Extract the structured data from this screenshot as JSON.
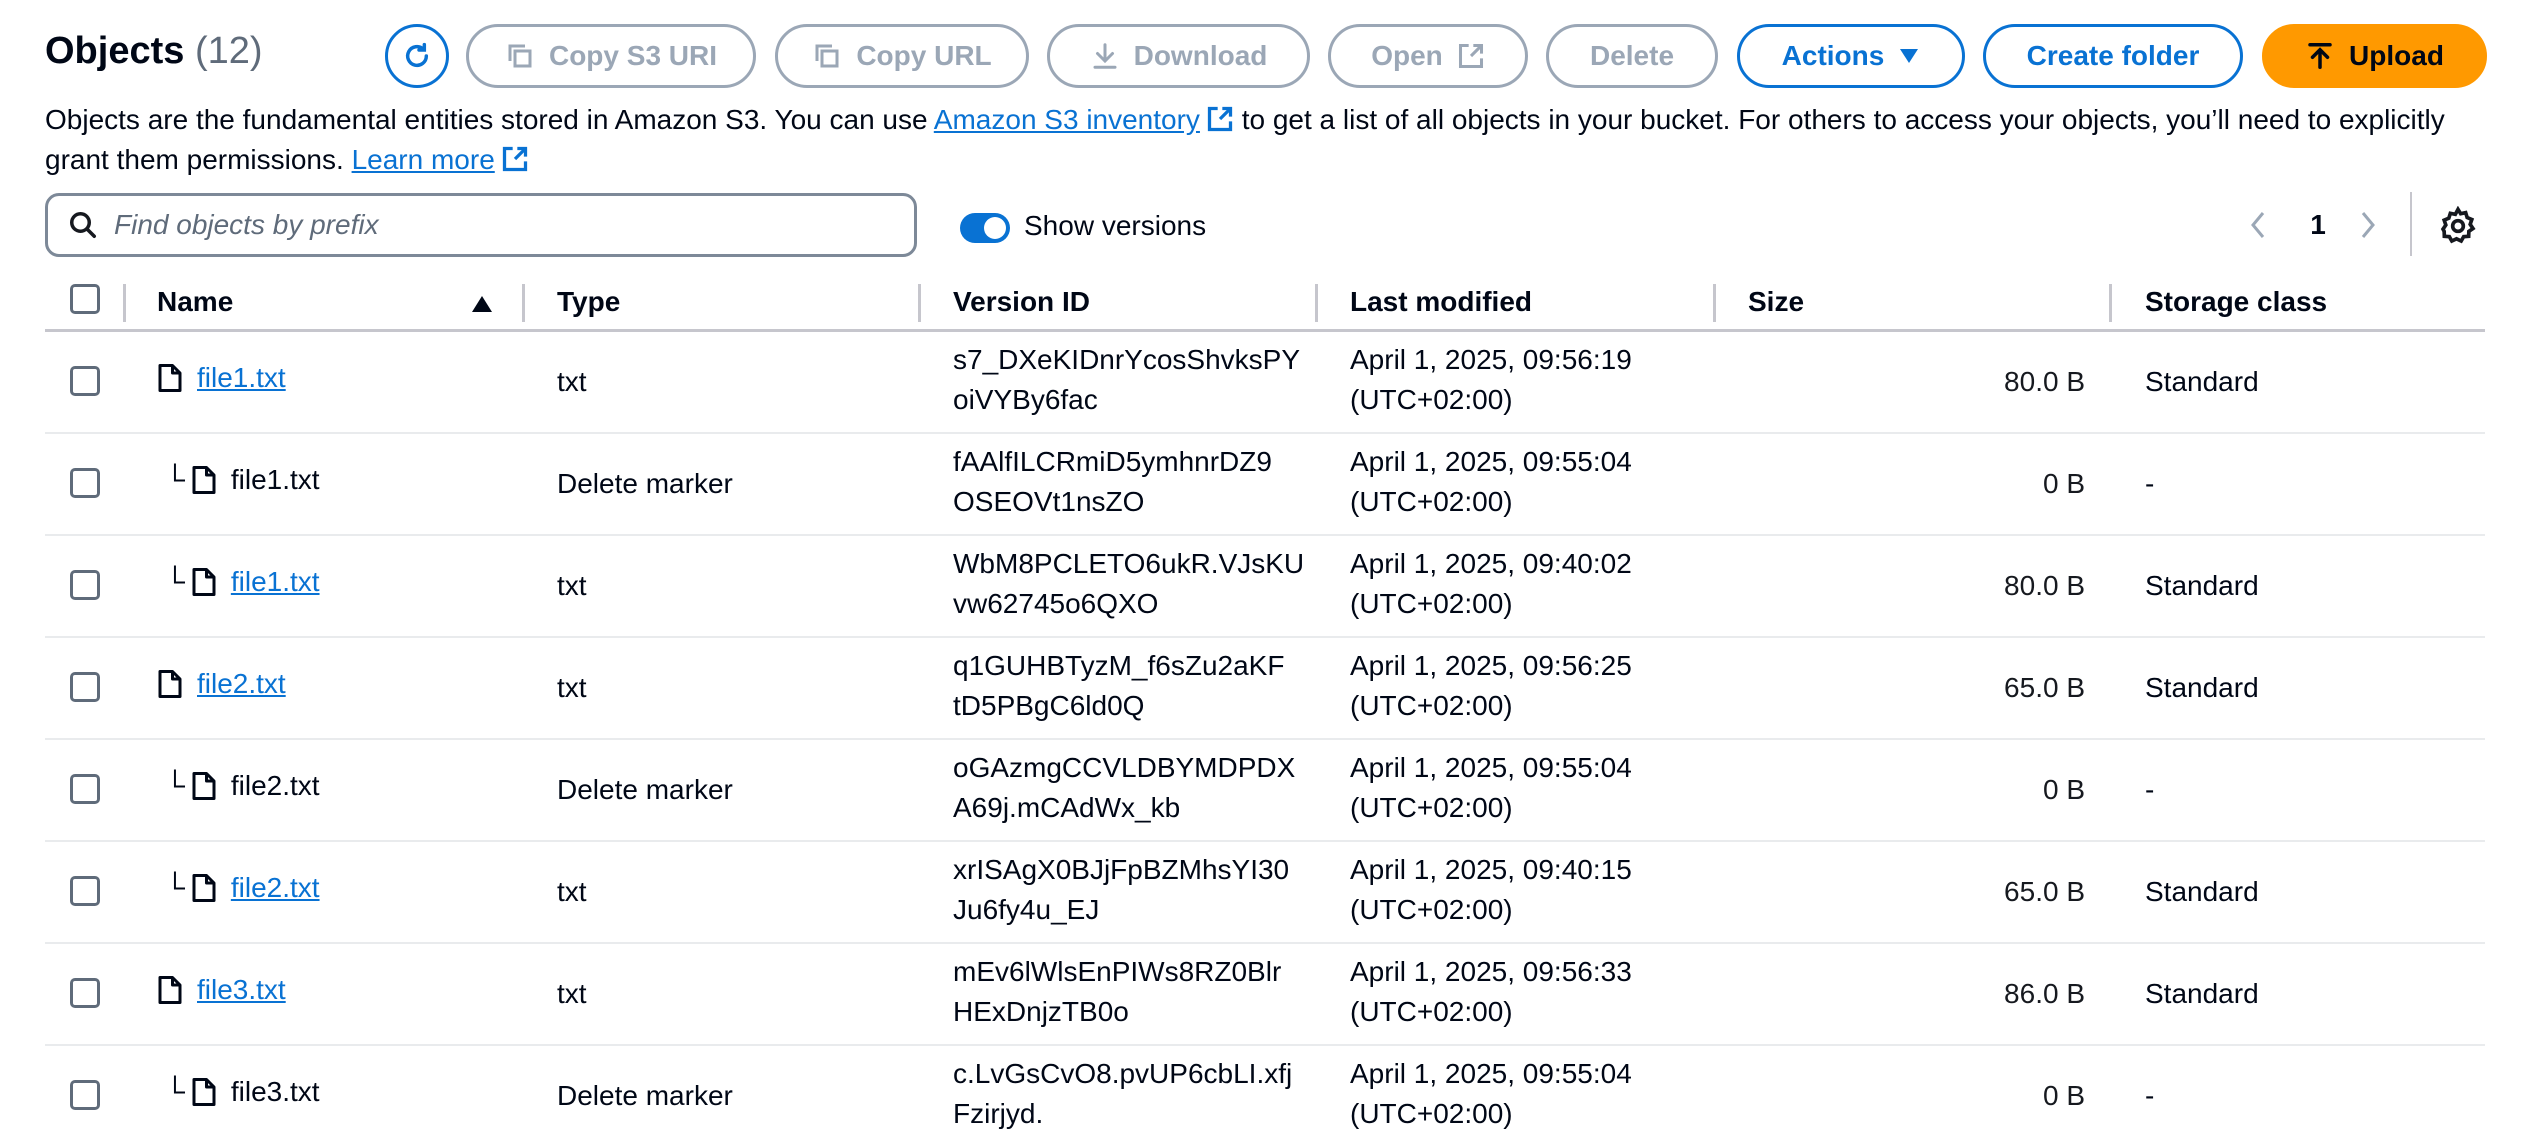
{
  "header": {
    "title": "Objects",
    "count": "(12)",
    "buttons": {
      "copy_s3_uri": "Copy S3 URI",
      "copy_url": "Copy URL",
      "download": "Download",
      "open": "Open",
      "delete": "Delete",
      "actions": "Actions",
      "create_folder": "Create folder",
      "upload": "Upload"
    }
  },
  "description": {
    "part1": "Objects are the fundamental entities stored in Amazon S3. You can use ",
    "inventory_link": "Amazon S3 inventory",
    "part2": " to get a list of all objects in your bucket. For others to access your objects, you’ll need to explicitly grant them permissions. ",
    "learn_more": "Learn more"
  },
  "search": {
    "placeholder": "Find objects by prefix"
  },
  "versions_toggle": {
    "label": "Show versions",
    "on": true
  },
  "pagination": {
    "page": "1"
  },
  "table": {
    "columns": {
      "name": "Name",
      "type": "Type",
      "version_id": "Version ID",
      "last_modified": "Last modified",
      "size": "Size",
      "storage_class": "Storage class"
    },
    "rows": [
      {
        "name": "file1.txt",
        "child": false,
        "link": true,
        "type": "txt",
        "version1": "s7_DXeKIDnrYcosShvksPY",
        "version2": "oiVYBy6fac",
        "date": "April 1, 2025, 09:56:19",
        "tz": "(UTC+02:00)",
        "size": "80.0 B",
        "storage": "Standard"
      },
      {
        "name": "file1.txt",
        "child": true,
        "link": false,
        "type": "Delete marker",
        "version1": "fAAlfILCRmiD5ymhnrDZ9",
        "version2": "OSEOVt1nsZO",
        "date": "April 1, 2025, 09:55:04",
        "tz": "(UTC+02:00)",
        "size": "0 B",
        "storage": "-"
      },
      {
        "name": "file1.txt",
        "child": true,
        "link": true,
        "type": "txt",
        "version1": "WbM8PCLETO6ukR.VJsKU",
        "version2": "vw62745o6QXO",
        "date": "April 1, 2025, 09:40:02",
        "tz": "(UTC+02:00)",
        "size": "80.0 B",
        "storage": "Standard"
      },
      {
        "name": "file2.txt",
        "child": false,
        "link": true,
        "type": "txt",
        "version1": "q1GUHBTyzM_f6sZu2aKF",
        "version2": "tD5PBgC6ld0Q",
        "date": "April 1, 2025, 09:56:25",
        "tz": "(UTC+02:00)",
        "size": "65.0 B",
        "storage": "Standard"
      },
      {
        "name": "file2.txt",
        "child": true,
        "link": false,
        "type": "Delete marker",
        "version1": "oGAzmgCCVLDBYMDPDX",
        "version2": "A69j.mCAdWx_kb",
        "date": "April 1, 2025, 09:55:04",
        "tz": "(UTC+02:00)",
        "size": "0 B",
        "storage": "-"
      },
      {
        "name": "file2.txt",
        "child": true,
        "link": true,
        "type": "txt",
        "version1": "xrISAgX0BJjFpBZMhsYI30",
        "version2": "Ju6fy4u_EJ",
        "date": "April 1, 2025, 09:40:15",
        "tz": "(UTC+02:00)",
        "size": "65.0 B",
        "storage": "Standard"
      },
      {
        "name": "file3.txt",
        "child": false,
        "link": true,
        "type": "txt",
        "version1": "mEv6lWlsEnPIWs8RZ0Blr",
        "version2": "HExDnjzTB0o",
        "date": "April 1, 2025, 09:56:33",
        "tz": "(UTC+02:00)",
        "size": "86.0 B",
        "storage": "Standard"
      },
      {
        "name": "file3.txt",
        "child": true,
        "link": false,
        "type": "Delete marker",
        "version1": "c.LvGsCvO8.pvUP6cbLI.xfj",
        "version2": "Fzirjyd.",
        "date": "April 1, 2025, 09:55:04",
        "tz": "(UTC+02:00)",
        "size": "0 B",
        "storage": "-"
      }
    ]
  },
  "colors": {
    "accent": "#0972d3",
    "upload": "#ff9900",
    "disabled": "#9ba7b6"
  }
}
